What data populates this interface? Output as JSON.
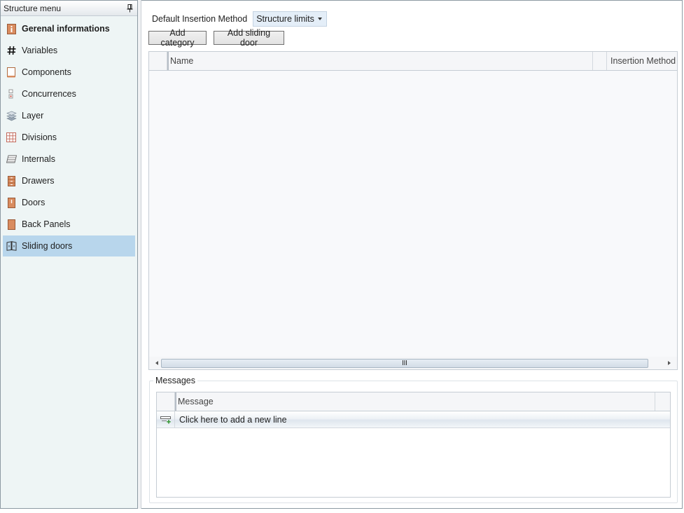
{
  "sidebar": {
    "title": "Structure menu",
    "items": [
      {
        "label": "Gerenal informations",
        "icon": "info-panel-icon",
        "selected": false,
        "bold": true
      },
      {
        "label": "Variables",
        "icon": "hash-icon",
        "selected": false,
        "bold": false
      },
      {
        "label": "Components",
        "icon": "component-icon",
        "selected": false,
        "bold": false
      },
      {
        "label": "Concurrences",
        "icon": "concurrence-icon",
        "selected": false,
        "bold": false
      },
      {
        "label": "Layer",
        "icon": "layers-icon",
        "selected": false,
        "bold": false
      },
      {
        "label": "Divisions",
        "icon": "grid-divisions-icon",
        "selected": false,
        "bold": false
      },
      {
        "label": "Internals",
        "icon": "shelf-icon",
        "selected": false,
        "bold": false
      },
      {
        "label": "Drawers",
        "icon": "drawers-icon",
        "selected": false,
        "bold": false
      },
      {
        "label": "Doors",
        "icon": "door-icon",
        "selected": false,
        "bold": false
      },
      {
        "label": "Back Panels",
        "icon": "back-panel-icon",
        "selected": false,
        "bold": false
      },
      {
        "label": "Sliding doors",
        "icon": "sliding-door-icon",
        "selected": true,
        "bold": false
      }
    ]
  },
  "main": {
    "default_insertion_label": "Default Insertion Method",
    "default_insertion_value": "Structure limits",
    "add_category_label": "Add category",
    "add_sliding_door_label": "Add sliding door",
    "grid": {
      "columns": [
        "Name",
        "Insertion Method"
      ],
      "rows": []
    },
    "messages": {
      "group_label": "Messages",
      "column": "Message",
      "new_line_text": "Click here to add a new line",
      "rows": []
    }
  },
  "colors": {
    "sidebar_bg": "#eef5f5",
    "selected_bg": "#b8d6ec",
    "combo_bg": "#e4eef8",
    "icon_wood": "#d98c5f",
    "border": "#8d9aa3"
  }
}
